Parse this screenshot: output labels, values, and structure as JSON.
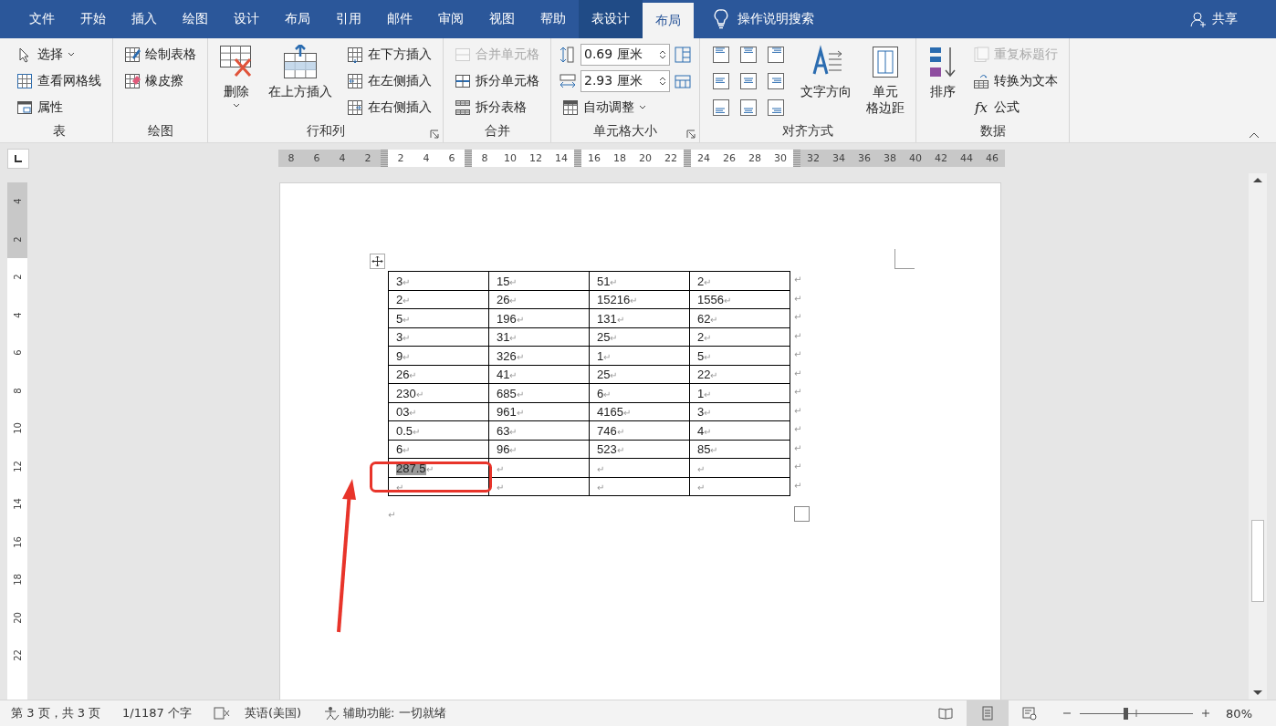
{
  "tabs": [
    {
      "label": "文件",
      "selected": false,
      "contextual": false
    },
    {
      "label": "开始",
      "selected": false,
      "contextual": false
    },
    {
      "label": "插入",
      "selected": false,
      "contextual": false
    },
    {
      "label": "绘图",
      "selected": false,
      "contextual": false
    },
    {
      "label": "设计",
      "selected": false,
      "contextual": false
    },
    {
      "label": "布局",
      "selected": false,
      "contextual": false
    },
    {
      "label": "引用",
      "selected": false,
      "contextual": false
    },
    {
      "label": "邮件",
      "selected": false,
      "contextual": false
    },
    {
      "label": "审阅",
      "selected": false,
      "contextual": false
    },
    {
      "label": "视图",
      "selected": false,
      "contextual": false
    },
    {
      "label": "帮助",
      "selected": false,
      "contextual": false
    },
    {
      "label": "表设计",
      "selected": false,
      "contextual": true
    },
    {
      "label": "布局",
      "selected": true,
      "contextual": true
    }
  ],
  "tell_me": "操作说明搜索",
  "share": "共享",
  "ribbon": {
    "groups": [
      {
        "label": "表",
        "launcher": false,
        "columns": [
          [
            {
              "kind": "small",
              "label": "选择",
              "dropdown": true,
              "disabled": false
            },
            {
              "kind": "small",
              "label": "查看网格线",
              "dropdown": false,
              "disabled": false
            },
            {
              "kind": "small",
              "label": "属性",
              "dropdown": false,
              "disabled": false
            }
          ]
        ]
      },
      {
        "label": "绘图",
        "launcher": false,
        "columns": [
          [
            {
              "kind": "small",
              "label": "绘制表格",
              "dropdown": false,
              "disabled": false
            },
            {
              "kind": "small",
              "label": "橡皮擦",
              "dropdown": false,
              "disabled": false
            }
          ]
        ]
      },
      {
        "label": "行和列",
        "launcher": true,
        "columns": [
          [
            {
              "kind": "large",
              "lines": [
                "删除"
              ],
              "dropdown": true,
              "disabled": false
            }
          ],
          [
            {
              "kind": "large",
              "lines": [
                "在上方插入"
              ],
              "dropdown": false,
              "disabled": false
            }
          ],
          [
            {
              "kind": "small",
              "label": "在下方插入",
              "dropdown": false,
              "disabled": false
            },
            {
              "kind": "small",
              "label": "在左侧插入",
              "dropdown": false,
              "disabled": false
            },
            {
              "kind": "small",
              "label": "在右侧插入",
              "dropdown": false,
              "disabled": false
            }
          ]
        ]
      },
      {
        "label": "合并",
        "launcher": false,
        "columns": [
          [
            {
              "kind": "small",
              "label": "合并单元格",
              "dropdown": false,
              "disabled": true
            },
            {
              "kind": "small",
              "label": "拆分单元格",
              "dropdown": false,
              "disabled": false
            },
            {
              "kind": "small",
              "label": "拆分表格",
              "dropdown": false,
              "disabled": false
            }
          ]
        ]
      },
      {
        "label": "单元格大小",
        "launcher": true,
        "columns": [
          [
            {
              "kind": "spin",
              "value": "0.69 厘米"
            },
            {
              "kind": "spin",
              "value": "2.93 厘米"
            },
            {
              "kind": "small",
              "label": "自动调整",
              "dropdown": true,
              "disabled": false
            }
          ]
        ]
      },
      {
        "label": "对齐方式",
        "launcher": false,
        "columns": [
          [
            {
              "kind": "align-grid"
            }
          ],
          [
            {
              "kind": "large",
              "lines": [
                "文字方向"
              ],
              "dropdown": false,
              "disabled": false
            }
          ],
          [
            {
              "kind": "large",
              "lines": [
                "单元",
                "格边距"
              ],
              "dropdown": false,
              "disabled": false
            }
          ]
        ]
      },
      {
        "label": "数据",
        "launcher": false,
        "columns": [
          [
            {
              "kind": "large",
              "lines": [
                "排序"
              ],
              "dropdown": false,
              "disabled": false
            }
          ],
          [
            {
              "kind": "small",
              "label": "重复标题行",
              "dropdown": false,
              "disabled": true
            },
            {
              "kind": "small",
              "label": "转换为文本",
              "dropdown": false,
              "disabled": false
            },
            {
              "kind": "small",
              "label": "公式",
              "glyph": "fx",
              "dropdown": false,
              "disabled": false
            }
          ]
        ]
      }
    ]
  },
  "ruler": {
    "segments": [
      {
        "margin": true,
        "labels": [
          "8",
          "6",
          "4",
          "2"
        ]
      },
      {
        "margin": false,
        "labels": [
          "2",
          "4",
          "6"
        ]
      },
      {
        "margin": false,
        "labels": [
          "8",
          "10",
          "12",
          "14"
        ]
      },
      {
        "margin": false,
        "labels": [
          "16",
          "18",
          "20",
          "22"
        ]
      },
      {
        "margin": false,
        "labels": [
          "24",
          "26",
          "28",
          "30"
        ]
      },
      {
        "margin": true,
        "labels": [
          "32",
          "34",
          "36",
          "38",
          "40",
          "42",
          "44",
          "46"
        ]
      }
    ]
  },
  "vertical_ruler": {
    "segments": [
      {
        "margin": true,
        "labels": [
          "4",
          "2"
        ]
      },
      {
        "margin": false,
        "labels": [
          "2",
          "4",
          "6",
          "8",
          "10",
          "12",
          "14",
          "16",
          "18",
          "20",
          "22"
        ]
      }
    ]
  },
  "document": {
    "table": {
      "rows": [
        {
          "end_mark": "↵",
          "cells": [
            {
              "text": "3",
              "mark": "↵",
              "highlighted": false
            },
            {
              "text": "15",
              "mark": "↵",
              "highlighted": false
            },
            {
              "text": "51",
              "mark": "↵",
              "highlighted": false
            },
            {
              "text": "2",
              "mark": "↵",
              "highlighted": false
            }
          ]
        },
        {
          "end_mark": "↵",
          "cells": [
            {
              "text": "2",
              "mark": "↵",
              "highlighted": false
            },
            {
              "text": "26",
              "mark": "↵",
              "highlighted": false
            },
            {
              "text": "15216",
              "mark": "↵",
              "highlighted": false
            },
            {
              "text": "1556",
              "mark": "↵",
              "highlighted": false
            }
          ]
        },
        {
          "end_mark": "↵",
          "cells": [
            {
              "text": "5",
              "mark": "↵",
              "highlighted": false
            },
            {
              "text": "196",
              "mark": "↵",
              "highlighted": false
            },
            {
              "text": "131",
              "mark": "↵",
              "highlighted": false
            },
            {
              "text": "62",
              "mark": "↵",
              "highlighted": false
            }
          ]
        },
        {
          "end_mark": "↵",
          "cells": [
            {
              "text": "3",
              "mark": "↵",
              "highlighted": false
            },
            {
              "text": "31",
              "mark": "↵",
              "highlighted": false
            },
            {
              "text": "25",
              "mark": "↵",
              "highlighted": false
            },
            {
              "text": "2",
              "mark": "↵",
              "highlighted": false
            }
          ]
        },
        {
          "end_mark": "↵",
          "cells": [
            {
              "text": "9",
              "mark": "↵",
              "highlighted": false
            },
            {
              "text": "326",
              "mark": "↵",
              "highlighted": false
            },
            {
              "text": "1",
              "mark": "↵",
              "highlighted": false
            },
            {
              "text": "5",
              "mark": "↵",
              "highlighted": false
            }
          ]
        },
        {
          "end_mark": "↵",
          "cells": [
            {
              "text": "26",
              "mark": "↵",
              "highlighted": false
            },
            {
              "text": "41",
              "mark": "↵",
              "highlighted": false
            },
            {
              "text": "25",
              "mark": "↵",
              "highlighted": false
            },
            {
              "text": "22",
              "mark": "↵",
              "highlighted": false
            }
          ]
        },
        {
          "end_mark": "↵",
          "cells": [
            {
              "text": "230",
              "mark": "↵",
              "highlighted": false
            },
            {
              "text": "685",
              "mark": "↵",
              "highlighted": false
            },
            {
              "text": "6",
              "mark": "↵",
              "highlighted": false
            },
            {
              "text": "1",
              "mark": "↵",
              "highlighted": false
            }
          ]
        },
        {
          "end_mark": "↵",
          "cells": [
            {
              "text": "03",
              "mark": "↵",
              "highlighted": false
            },
            {
              "text": "961",
              "mark": "↵",
              "highlighted": false
            },
            {
              "text": "4165",
              "mark": "↵",
              "highlighted": false
            },
            {
              "text": "3",
              "mark": "↵",
              "highlighted": false
            }
          ]
        },
        {
          "end_mark": "↵",
          "cells": [
            {
              "text": "0.5",
              "mark": "↵",
              "highlighted": false
            },
            {
              "text": "63",
              "mark": "↵",
              "highlighted": false
            },
            {
              "text": "746",
              "mark": "↵",
              "highlighted": false
            },
            {
              "text": "4",
              "mark": "↵",
              "highlighted": false
            }
          ]
        },
        {
          "end_mark": "↵",
          "cells": [
            {
              "text": "6",
              "mark": "↵",
              "highlighted": false
            },
            {
              "text": "96",
              "mark": "↵",
              "highlighted": false
            },
            {
              "text": "523",
              "mark": "↵",
              "highlighted": false
            },
            {
              "text": "85",
              "mark": "↵",
              "highlighted": false
            }
          ]
        },
        {
          "end_mark": "↵",
          "cells": [
            {
              "text": "287.5",
              "mark": "↵",
              "highlighted": true
            },
            {
              "mark": "↵",
              "highlighted": false
            },
            {
              "mark": "↵",
              "highlighted": false
            },
            {
              "mark": "↵",
              "highlighted": false
            }
          ]
        },
        {
          "end_mark": "↵",
          "cells": [
            {
              "mark": "↵",
              "highlighted": false
            },
            {
              "mark": "↵",
              "highlighted": false
            },
            {
              "mark": "↵",
              "highlighted": false
            },
            {
              "mark": "↵",
              "highlighted": false
            }
          ]
        }
      ]
    },
    "after_mark": "↵"
  },
  "status_bar": {
    "page": "第 3 页，共 3 页",
    "words": "1/1187 个字",
    "language": "英语(美国)",
    "accessibility": "辅助功能: 一切就绪",
    "views": [
      {
        "selected": false
      },
      {
        "selected": true
      },
      {
        "selected": false
      }
    ],
    "zoom": {
      "level": 0.4,
      "label": "80%"
    }
  }
}
